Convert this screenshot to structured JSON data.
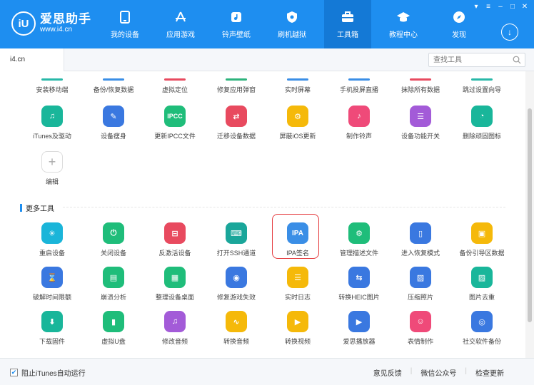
{
  "app": {
    "name": "爱思助手",
    "url": "www.i4.cn",
    "logo_mark": "iU"
  },
  "nav": [
    {
      "label": "我的设备",
      "icon": "phone-icon"
    },
    {
      "label": "应用游戏",
      "icon": "appstore-icon"
    },
    {
      "label": "铃声壁纸",
      "icon": "music-icon"
    },
    {
      "label": "刷机越狱",
      "icon": "shield-icon"
    },
    {
      "label": "工具箱",
      "icon": "toolbox-icon",
      "active": true
    },
    {
      "label": "教程中心",
      "icon": "graduation-icon"
    },
    {
      "label": "发现",
      "icon": "compass-icon"
    }
  ],
  "tab": {
    "label": "i4.cn"
  },
  "search": {
    "placeholder": "查找工具"
  },
  "toprow": [
    {
      "label": "安装移动端",
      "color": "#28b8a8"
    },
    {
      "label": "备份/恢复数据",
      "color": "#3a8ee6"
    },
    {
      "label": "虚拟定位",
      "color": "#e84a5f"
    },
    {
      "label": "修复应用弹窗",
      "color": "#2db37c"
    },
    {
      "label": "实时屏幕",
      "color": "#3a8ee6"
    },
    {
      "label": "手机投屏直播",
      "color": "#3a8ee6"
    },
    {
      "label": "抹除所有数据",
      "color": "#e84a5f"
    },
    {
      "label": "跳过设置向导",
      "color": "#28b8a8"
    }
  ],
  "row1": [
    {
      "label": "iTunes及驱动",
      "color": "#19b69a",
      "glyph": "♫"
    },
    {
      "label": "设备瘦身",
      "color": "#3a78e0",
      "glyph": "✎"
    },
    {
      "label": "更新IPCC文件",
      "color": "#1fbd7a",
      "glyph": "IPCC"
    },
    {
      "label": "迁移设备数据",
      "color": "#e84a5f",
      "glyph": "⇄"
    },
    {
      "label": "屏蔽iOS更新",
      "color": "#f5b90a",
      "glyph": "⚙"
    },
    {
      "label": "制作铃声",
      "color": "#ef4a79",
      "glyph": "♪"
    },
    {
      "label": "设备功能开关",
      "color": "#a35bd8",
      "glyph": "☰"
    },
    {
      "label": "删除顽固图标",
      "color": "#19b69a",
      "glyph": "◔"
    }
  ],
  "edit": {
    "label": "编辑",
    "glyph": "+"
  },
  "section": {
    "title": "更多工具"
  },
  "row2": [
    {
      "label": "重启设备",
      "color": "#1ab5d9",
      "glyph": "✳"
    },
    {
      "label": "关闭设备",
      "color": "#1fbd7a",
      "glyph": "⏻"
    },
    {
      "label": "反激活设备",
      "color": "#e84a5f",
      "glyph": "⊟"
    },
    {
      "label": "打开SSH通道",
      "color": "#1aa69a",
      "glyph": "⌨"
    },
    {
      "label": "IPA签名",
      "color": "#3a8ee6",
      "glyph": "IPA"
    },
    {
      "label": "管理描述文件",
      "color": "#1fbd7a",
      "glyph": "⚙"
    },
    {
      "label": "进入恢复模式",
      "color": "#3a78e0",
      "glyph": "▯"
    },
    {
      "label": "备份引导区数据",
      "color": "#f5b90a",
      "glyph": "▣"
    }
  ],
  "row3": [
    {
      "label": "破解时间限额",
      "color": "#3a78e0",
      "glyph": "⌛"
    },
    {
      "label": "崩溃分析",
      "color": "#1fbd7a",
      "glyph": "▤"
    },
    {
      "label": "整理设备桌面",
      "color": "#1fbd7a",
      "glyph": "▦"
    },
    {
      "label": "修复游戏失效",
      "color": "#3a78e0",
      "glyph": "◉"
    },
    {
      "label": "实时日志",
      "color": "#f5b90a",
      "glyph": "☰"
    },
    {
      "label": "转换HEIC图片",
      "color": "#3a78e0",
      "glyph": "⇆"
    },
    {
      "label": "压缩照片",
      "color": "#3a78e0",
      "glyph": "▨"
    },
    {
      "label": "图片去重",
      "color": "#19b69a",
      "glyph": "▨"
    }
  ],
  "row4": [
    {
      "label": "下载固件",
      "color": "#19b69a",
      "glyph": "⬇"
    },
    {
      "label": "虚拟U盘",
      "color": "#1fbd7a",
      "glyph": "▮"
    },
    {
      "label": "修改音频",
      "color": "#a35bd8",
      "glyph": "♫"
    },
    {
      "label": "转换音频",
      "color": "#f5b90a",
      "glyph": "∿"
    },
    {
      "label": "转换视频",
      "color": "#f5b90a",
      "glyph": "▶"
    },
    {
      "label": "爱思播放器",
      "color": "#3a78e0",
      "glyph": "▶"
    },
    {
      "label": "表情制作",
      "color": "#ef4a79",
      "glyph": "☺"
    },
    {
      "label": "社交软件备份",
      "color": "#3a78e0",
      "glyph": "◎"
    }
  ],
  "footer": {
    "checkbox_label": "阻止iTunes自动运行",
    "checked": true,
    "links": [
      "意见反馈",
      "微信公众号",
      "检查更新"
    ]
  }
}
